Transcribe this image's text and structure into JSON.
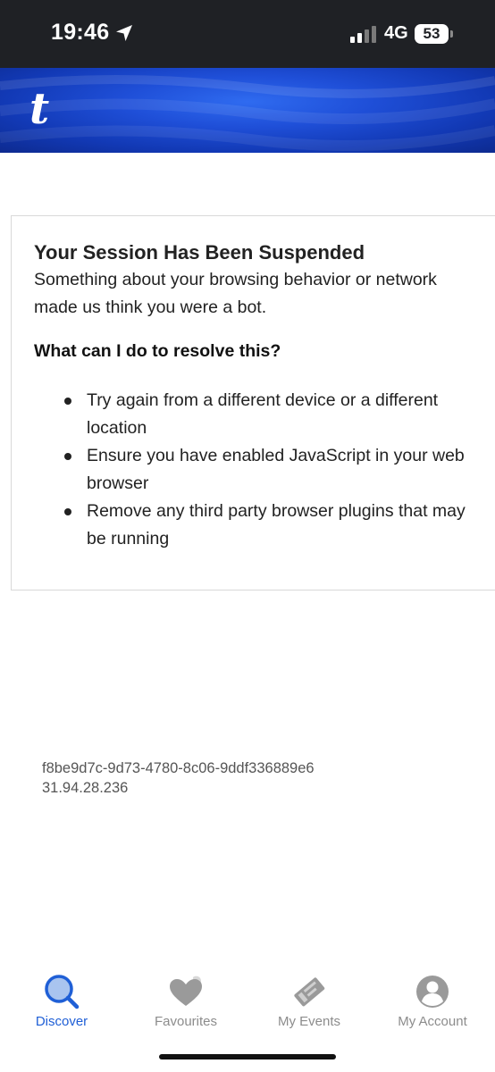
{
  "status_bar": {
    "time": "19:46",
    "network": "4G",
    "battery": "53"
  },
  "header": {
    "logo_text": "t",
    "brand_color": "#1f4fd8"
  },
  "card": {
    "title": "Your Session Has Been Suspended",
    "description": "Something about your browsing behavior or network made us think you were a bot.",
    "subtitle": "What can I do to resolve this?",
    "tips": [
      "Try again from a different device or a different location",
      "Ensure you have enabled JavaScript in your web browser",
      "Remove any third party browser plugins that may be running"
    ]
  },
  "reference": {
    "id": "f8be9d7c-9d73-4780-8c06-9ddf336889e6",
    "ip": "31.94.28.236"
  },
  "tab_bar": {
    "active_color": "#1f5fd6",
    "tabs": [
      {
        "label": "Discover",
        "icon": "search-icon",
        "active": true
      },
      {
        "label": "Favourites",
        "icon": "heart-icon",
        "active": false
      },
      {
        "label": "My Events",
        "icon": "ticket-icon",
        "active": false
      },
      {
        "label": "My Account",
        "icon": "account-icon",
        "active": false
      }
    ]
  }
}
